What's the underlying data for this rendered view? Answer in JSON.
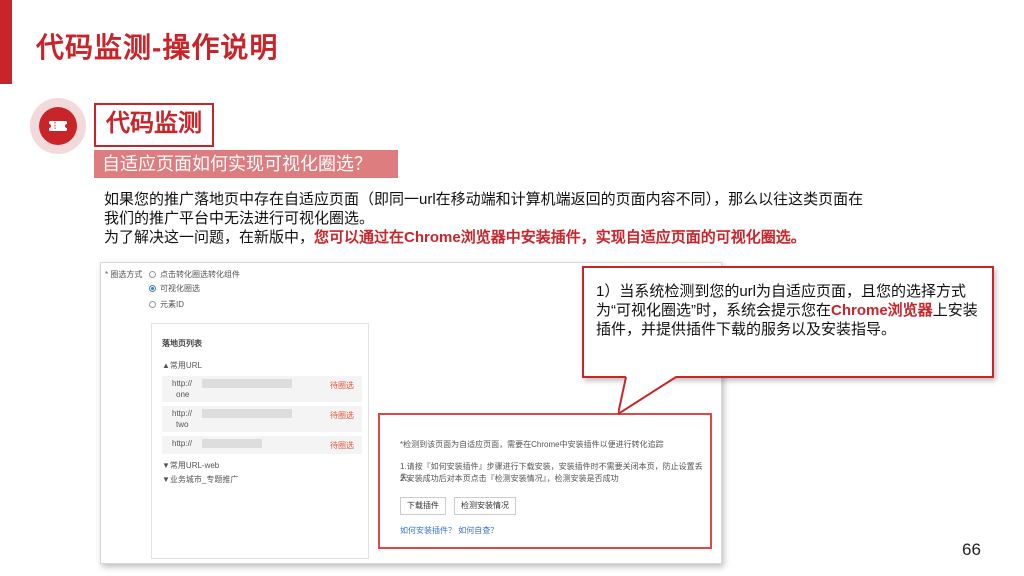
{
  "slide": {
    "title": "代码监测-操作说明",
    "page_number": "66",
    "accent_color": "#c8252b"
  },
  "section": {
    "icon": "ticket-icon",
    "title": "代码监测",
    "subtitle": "自适应页面如何实现可视化圈选？"
  },
  "description": {
    "line1": "如果您的推广落地页中存在自适应页面（即同一url在移动端和计算机端返回的页面内容不同），那么以往这类页面在",
    "line2": "我们的推广平台中无法进行可视化圈选。",
    "line3_prefix": "为了解决这一问题，在新版中，",
    "line3_highlight": "您可以通过在Chrome浏览器中安装插件，实现自适应页面的可视化圈选。"
  },
  "screenshot": {
    "radio_label": "* 圈选方式",
    "radio_options": [
      {
        "label": "点击转化圈选转化组件",
        "selected": false
      },
      {
        "label": "可视化圈选",
        "selected": true
      },
      {
        "label": "元素ID",
        "selected": false
      }
    ],
    "list_title": "落地页列表",
    "group1": "▲常用URL",
    "rows": [
      {
        "prefix": "http://",
        "suffix": "one",
        "status": "待圈选"
      },
      {
        "prefix": "http://",
        "suffix": "two",
        "status": "待圈选"
      },
      {
        "prefix": "http://",
        "suffix": "",
        "status": "待圈选"
      }
    ],
    "group2": "▼常用URL-web",
    "group3": "▼业务城市_专题推广",
    "dialog": {
      "message": "*检测到该页面为自适应页面，需要在Chrome中安装插件以便进行转化追踪",
      "step1": "1.请按『如何安装插件』步骤进行下载安装，安装插件时不需要关闭本页，防止设置丢失。",
      "step2": "2.安装成功后对本页点击『检测安装情况』，检测安装是否成功",
      "download_button": "下载插件",
      "check_button": "检测安装情况",
      "links": "如何安装插件？ 如何自查？"
    }
  },
  "callout": {
    "text_a": "1）当系统检测到您的url为自适应页面，且您的选择方式为“可视化圈选”时，系统会提示您在",
    "text_highlight": "Chrome浏览器",
    "text_b": "上安装插件，并提供插件下载的服务以及安装指导。"
  }
}
